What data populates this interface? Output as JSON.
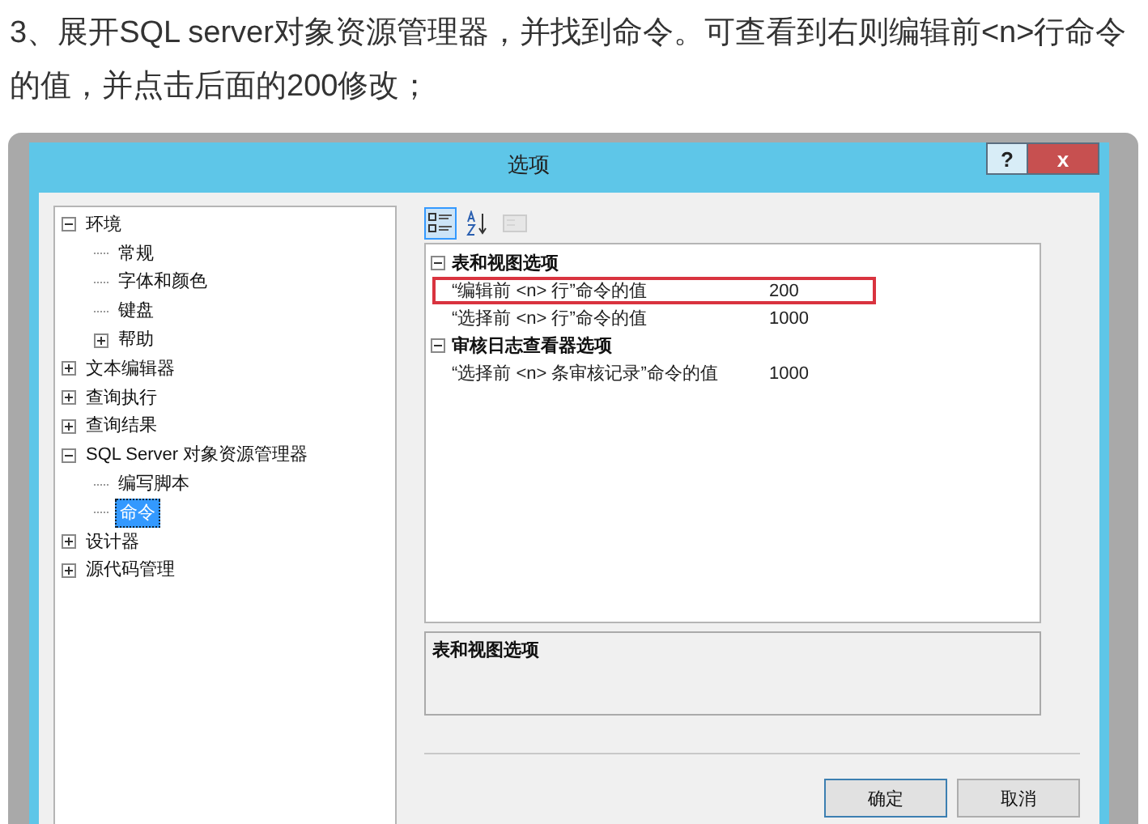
{
  "paragraph": "3、展开SQL server对象资源管理器，并找到命令。可查看到右则编辑前<n>行命令的值，并点击后面的200修改；",
  "dialog": {
    "title": "选项",
    "help_button": "?",
    "close_button": "x",
    "tree": [
      {
        "label": "环境",
        "expanded": true,
        "selected": false,
        "children": [
          {
            "label": "常规",
            "selected": false
          },
          {
            "label": "字体和颜色",
            "selected": false
          },
          {
            "label": "键盘",
            "selected": false
          },
          {
            "label": "帮助",
            "expanded": false,
            "selected": false
          }
        ]
      },
      {
        "label": "文本编辑器",
        "expanded": false,
        "selected": false
      },
      {
        "label": "查询执行",
        "expanded": false,
        "selected": false
      },
      {
        "label": "查询结果",
        "expanded": false,
        "selected": false
      },
      {
        "label": "SQL Server 对象资源管理器",
        "expanded": true,
        "selected": false,
        "children": [
          {
            "label": "编写脚本",
            "selected": false
          },
          {
            "label": "命令",
            "selected": true
          }
        ]
      },
      {
        "label": "设计器",
        "expanded": false,
        "selected": false
      },
      {
        "label": "源代码管理",
        "expanded": false,
        "selected": false
      }
    ],
    "toolbar": [
      {
        "kind": "categorized",
        "selected": true,
        "disabled": false
      },
      {
        "kind": "alphabetical",
        "selected": false,
        "disabled": false
      },
      {
        "kind": "pages",
        "selected": false,
        "disabled": true
      }
    ],
    "categories": [
      {
        "label": "表和视图选项",
        "expanded": true,
        "properties": [
          {
            "name": "“编辑前 <n> 行”命令的值",
            "value": "200",
            "highlighted": true
          },
          {
            "name": "“选择前 <n> 行”命令的值",
            "value": "1000",
            "highlighted": false
          }
        ]
      },
      {
        "label": "审核日志查看器选项",
        "expanded": true,
        "properties": [
          {
            "name": "“选择前 <n> 条审核记录”命令的值",
            "value": "1000",
            "highlighted": false
          }
        ]
      }
    ],
    "description": "表和视图选项",
    "buttons": [
      "确定",
      "取消"
    ]
  }
}
